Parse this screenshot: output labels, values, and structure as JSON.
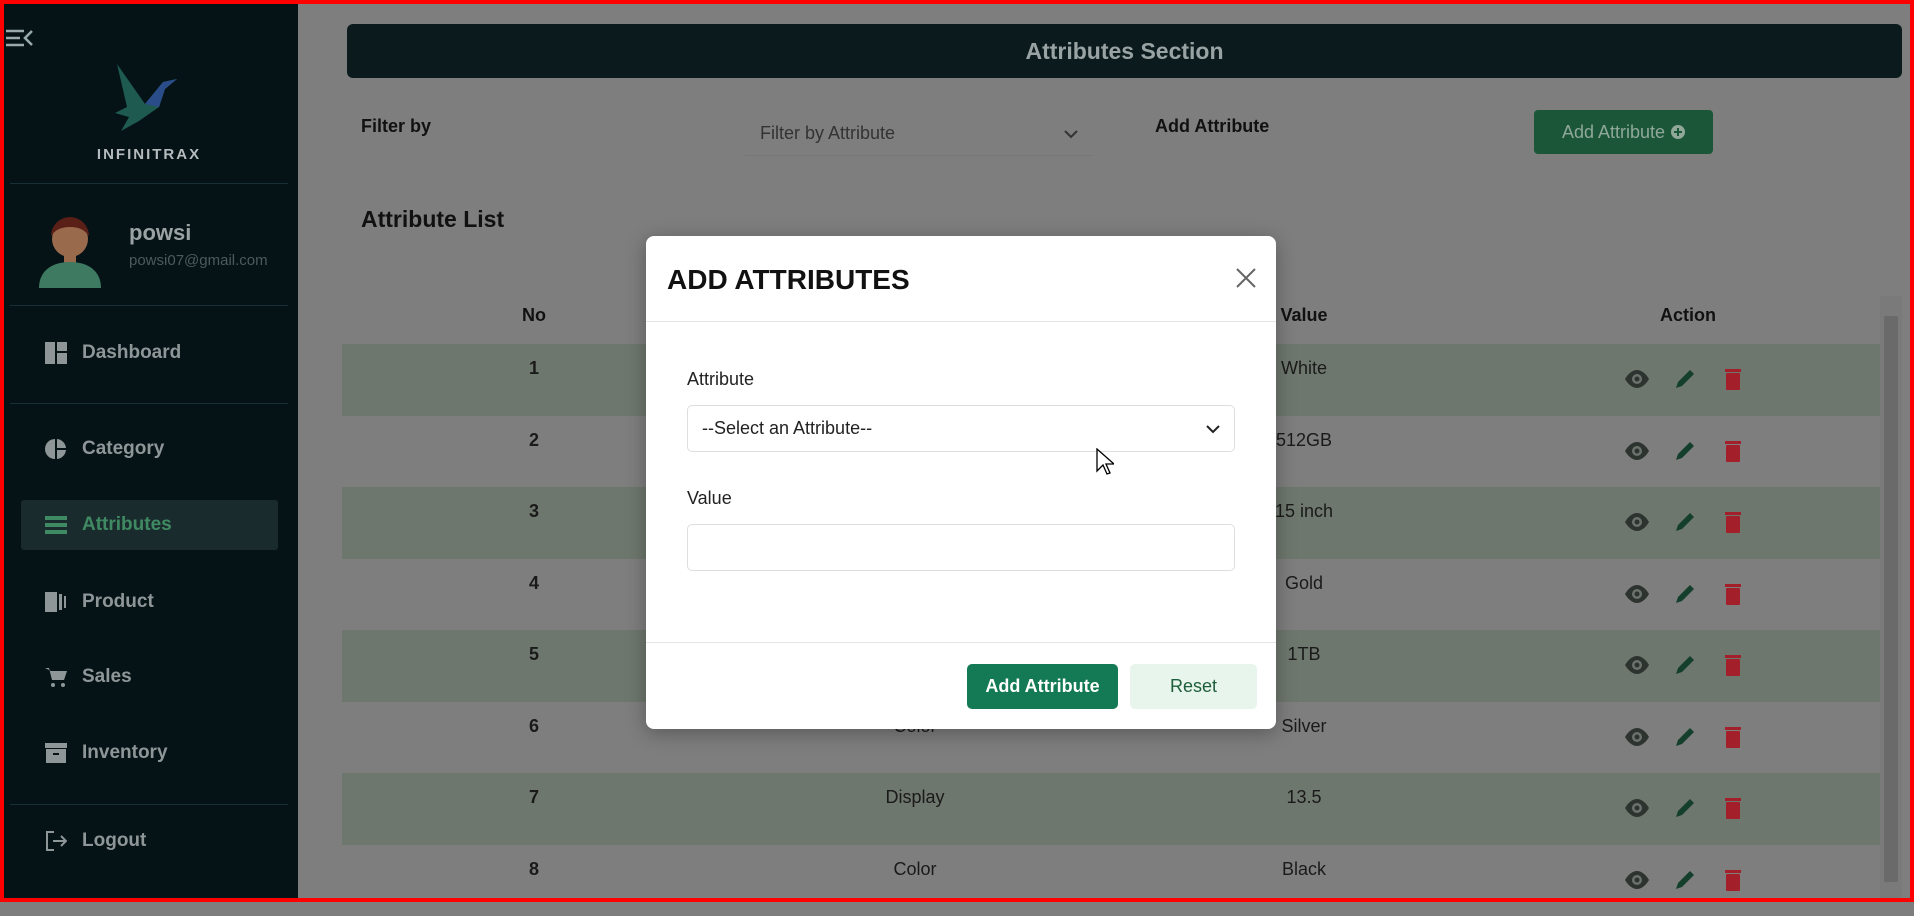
{
  "sidebar": {
    "brand": "INFINITRAX",
    "user": {
      "name": "powsi",
      "email": "powsi07@gmail.com"
    },
    "items": [
      {
        "label": "Dashboard",
        "icon": "dashboard-icon"
      },
      {
        "label": "Category",
        "icon": "pie-chart-icon"
      },
      {
        "label": "Attributes",
        "icon": "list-icon",
        "active": true
      },
      {
        "label": "Product",
        "icon": "product-icon"
      },
      {
        "label": "Sales",
        "icon": "cart-icon"
      },
      {
        "label": "Inventory",
        "icon": "archive-icon"
      }
    ],
    "logout": "Logout"
  },
  "header": {
    "title": "Attributes Section"
  },
  "filter": {
    "label": "Filter by",
    "select_value": "Filter by Attribute",
    "add_label": "Add Attribute",
    "add_button": "Add Attribute"
  },
  "list": {
    "title": "Attribute List",
    "columns": [
      "No",
      "",
      "Value",
      "Action"
    ],
    "rows": [
      {
        "no": "1",
        "attribute": "",
        "value": "White"
      },
      {
        "no": "2",
        "attribute": "",
        "value": "512GB"
      },
      {
        "no": "3",
        "attribute": "",
        "value": "15 inch"
      },
      {
        "no": "4",
        "attribute": "",
        "value": "Gold"
      },
      {
        "no": "5",
        "attribute": "",
        "value": "1TB"
      },
      {
        "no": "6",
        "attribute": "Color",
        "value": "Silver"
      },
      {
        "no": "7",
        "attribute": "Display",
        "value": "13.5"
      },
      {
        "no": "8",
        "attribute": "Color",
        "value": "Black"
      }
    ]
  },
  "modal": {
    "title": "ADD ATTRIBUTES",
    "attribute_label": "Attribute",
    "attribute_select": "--Select an Attribute--",
    "value_label": "Value",
    "value_input": "",
    "submit": "Add Attribute",
    "reset": "Reset"
  },
  "colors": {
    "accent": "#137a55",
    "delete": "#a3202a",
    "sidebar": "#051317"
  }
}
